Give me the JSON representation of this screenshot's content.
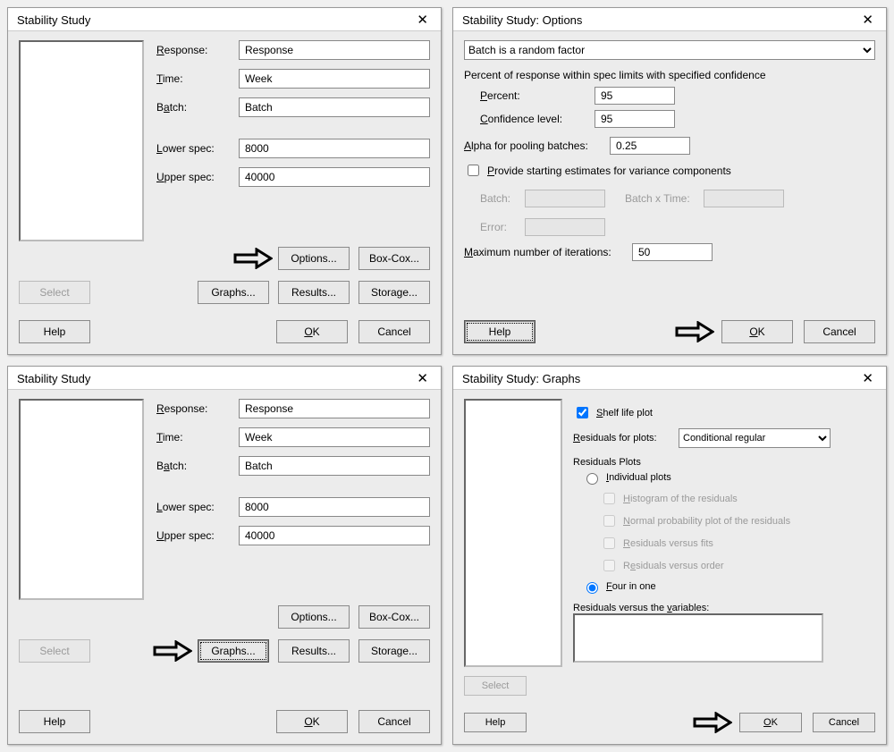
{
  "dlg1": {
    "title": "Stability Study",
    "labels": {
      "response": "Response:",
      "time": "Time:",
      "batch": "Batch:",
      "lower": "Lower spec:",
      "upper": "Upper spec:"
    },
    "values": {
      "response": "Response",
      "time": "Week",
      "batch": "Batch",
      "lower": "8000",
      "upper": "40000"
    },
    "buttons": {
      "select": "Select",
      "options": "Options...",
      "boxcox": "Box-Cox...",
      "graphs": "Graphs...",
      "results": "Results...",
      "storage": "Storage...",
      "help": "Help",
      "ok": "OK",
      "cancel": "Cancel"
    }
  },
  "dlg2": {
    "title": "Stability Study: Options",
    "combo_value": "Batch is a random factor",
    "heading": "Percent of response within spec limits with specified confidence",
    "percent_label": "Percent:",
    "percent_value": "95",
    "conf_label": "Confidence level:",
    "conf_value": "95",
    "alpha_label": "Alpha for pooling batches:",
    "alpha_value": "0.25",
    "chk_provide": "Provide starting estimates for variance components",
    "batch_label": "Batch:",
    "bxt_label": "Batch x Time:",
    "error_label": "Error:",
    "maxit_label": "Maximum number of iterations:",
    "maxit_value": "50",
    "help": "Help",
    "ok": "OK",
    "cancel": "Cancel"
  },
  "dlg3": {
    "title": "Stability Study"
  },
  "dlg4": {
    "title": "Stability Study: Graphs",
    "shelf_life": "Shelf life plot",
    "resid_for_label": "Residuals for plots:",
    "resid_for_value": "Conditional regular",
    "resid_plots_heading": "Residuals Plots",
    "radio_individual": "Individual plots",
    "chk_hist": "Histogram of the residuals",
    "chk_npp": "Normal probability plot of the residuals",
    "chk_rvf": "Residuals versus fits",
    "chk_rvo": "Residuals versus order",
    "radio_four": "Four in one",
    "rv_vars": "Residuals versus the variables:",
    "select": "Select",
    "help": "Help",
    "ok": "OK",
    "cancel": "Cancel"
  }
}
